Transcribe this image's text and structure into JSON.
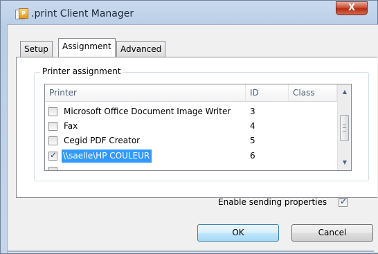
{
  "window": {
    "title": ".print Client Manager",
    "icon_label": "P",
    "close_glyph": "X"
  },
  "tabs": [
    {
      "label": "Setup",
      "active": false
    },
    {
      "label": "Assignment",
      "active": true
    },
    {
      "label": "Advanced",
      "active": false
    }
  ],
  "group": {
    "title": "Printer assignment"
  },
  "list": {
    "columns": [
      "Printer",
      "ID",
      "Class"
    ],
    "rows": [
      {
        "printer": "Microsoft Office Document Image Writer",
        "id": "3",
        "checked": false,
        "selected": false
      },
      {
        "printer": "Fax",
        "id": "4",
        "checked": false,
        "selected": false
      },
      {
        "printer": "Cegid PDF Creator",
        "id": "5",
        "checked": false,
        "selected": false
      },
      {
        "printer": "\\\\saelle\\HP COULEUR",
        "id": "6",
        "checked": true,
        "selected": true
      }
    ],
    "scroll_up": "▲",
    "scroll_down": "▼"
  },
  "options": {
    "enable_sending_label": "Enable sending properties",
    "enable_sending_checked": true
  },
  "buttons": {
    "ok": "OK",
    "cancel": "Cancel"
  },
  "colors": {
    "selection": "#3399ff",
    "close": "#c8472c"
  }
}
